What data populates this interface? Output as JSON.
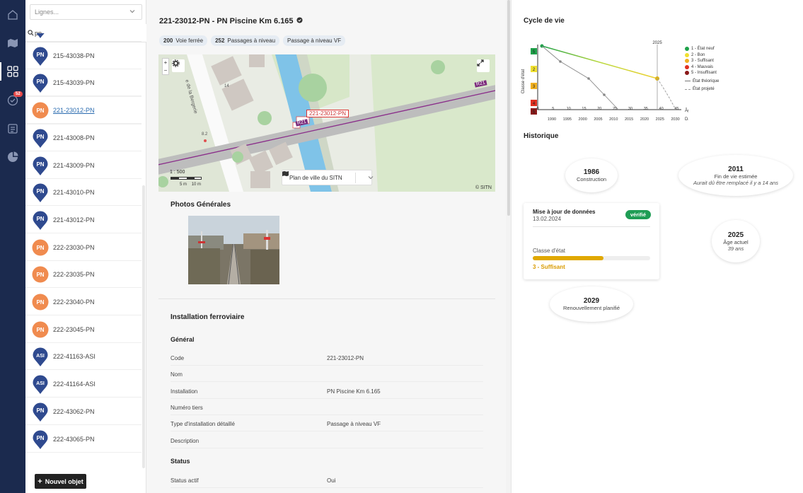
{
  "sidebar_list": {
    "lines_placeholder": "Lignes...",
    "search_value": "pn",
    "items": [
      {
        "label": "215-43035-PN",
        "kind": "PN",
        "color": "#2f4a8f",
        "shape": "pin"
      },
      {
        "label": "215-43038-PN",
        "kind": "PN",
        "color": "#2f4a8f",
        "shape": "pin"
      },
      {
        "label": "215-43039-PN",
        "kind": "PN",
        "color": "#2f4a8f",
        "shape": "pin"
      },
      {
        "label": "221-23012-PN",
        "kind": "PN",
        "color": "#f08b4f",
        "shape": "circle"
      },
      {
        "label": "221-43008-PN",
        "kind": "PN",
        "color": "#2f4a8f",
        "shape": "pin"
      },
      {
        "label": "221-43009-PN",
        "kind": "PN",
        "color": "#2f4a8f",
        "shape": "pin"
      },
      {
        "label": "221-43010-PN",
        "kind": "PN",
        "color": "#2f4a8f",
        "shape": "pin"
      },
      {
        "label": "221-43012-PN",
        "kind": "PN",
        "color": "#2f4a8f",
        "shape": "pin"
      },
      {
        "label": "222-23030-PN",
        "kind": "PN",
        "color": "#f08b4f",
        "shape": "circle"
      },
      {
        "label": "222-23035-PN",
        "kind": "PN",
        "color": "#f08b4f",
        "shape": "circle"
      },
      {
        "label": "222-23040-PN",
        "kind": "PN",
        "color": "#f08b4f",
        "shape": "circle"
      },
      {
        "label": "222-23045-PN",
        "kind": "PN",
        "color": "#f08b4f",
        "shape": "circle"
      },
      {
        "label": "222-41163-ASI",
        "kind": "ASI",
        "color": "#2f4a8f",
        "shape": "pin"
      },
      {
        "label": "222-41164-ASI",
        "kind": "ASI",
        "color": "#2f4a8f",
        "shape": "pin"
      },
      {
        "label": "222-43062-PN",
        "kind": "PN",
        "color": "#2f4a8f",
        "shape": "pin"
      },
      {
        "label": "222-43065-PN",
        "kind": "PN",
        "color": "#2f4a8f",
        "shape": "pin"
      }
    ],
    "selected_item": "221-23012-PN",
    "new_button_label": "Nouvel objet"
  },
  "rail": {
    "icons": [
      "home-icon",
      "map-icon",
      "grid-icon",
      "check-circle-icon",
      "document-icon",
      "pie-chart-icon"
    ],
    "badge_count": "52",
    "active_index": 2
  },
  "detail": {
    "title": "221-23012-PN - PN Piscine Km 6.165",
    "chips": [
      {
        "count": "200",
        "label": "Voie ferrée"
      },
      {
        "count": "252",
        "label": "Passages à niveau"
      },
      {
        "count": "",
        "label": "Passage à niveau VF"
      }
    ],
    "map": {
      "pn_label": "221-23012-PN",
      "road_labels": [
        "R21",
        "R21"
      ],
      "street_label": "e de la Bergerie",
      "scale_ratio": "1 : 500",
      "scale_units": [
        "5 m",
        "10 m"
      ],
      "plan_label": "Plan de ville du SITN",
      "attribution": "© SITN",
      "house_numbers": [
        "14",
        "8.2"
      ]
    },
    "photos_title": "Photos Générales",
    "install_title": "Installation ferroviaire",
    "general_title": "Général",
    "fields": [
      {
        "key": "Code",
        "value": "221-23012-PN"
      },
      {
        "key": "Nom",
        "value": ""
      },
      {
        "key": "Installation",
        "value": "PN Piscine Km 6.165"
      },
      {
        "key": "Numéro tiers",
        "value": ""
      },
      {
        "key": "Type d'installation détaillé",
        "value": "Passage à niveau VF"
      },
      {
        "key": "Description",
        "value": ""
      }
    ],
    "status_title": "Status",
    "status_fields": [
      {
        "key": "Status actif",
        "value": "Oui"
      }
    ]
  },
  "lifecycle": {
    "title": "Cycle de vie",
    "ylabel": "Classe d'état",
    "marker_year": "2025",
    "x_age_ticks": [
      "0",
      "5",
      "10",
      "15",
      "20",
      "25",
      "30",
      "35",
      "40",
      "45"
    ],
    "x_date_ticks": [
      "1990",
      "1995",
      "2000",
      "2005",
      "2010",
      "2015",
      "2020",
      "2025",
      "2030"
    ],
    "x_age_label": "Âge",
    "x_date_label": "Date",
    "y_classes": [
      "5",
      "2",
      "3",
      "4",
      "5"
    ],
    "y_class_colors": [
      "#1fa24a",
      "#f0e030",
      "#f0b020",
      "#e03020",
      "#8b1a1a"
    ],
    "legend": [
      {
        "label": "1 - État neuf",
        "color": "#1fa24a"
      },
      {
        "label": "2 - Bon",
        "color": "#f0e030"
      },
      {
        "label": "3 - Suffisant",
        "color": "#f0b020"
      },
      {
        "label": "4 - Mauvais",
        "color": "#e03020"
      },
      {
        "label": "5 - Insuffisant",
        "color": "#8b1a1a"
      },
      {
        "label": "État théorique",
        "color": "#777777"
      },
      {
        "label": "État projeté",
        "color": "#999999"
      }
    ]
  },
  "history": {
    "title": "Historique",
    "construction": {
      "year": "1986",
      "label": "Construction"
    },
    "end_of_life": {
      "year": "2011",
      "label": "Fin de vie estimée",
      "note": "Aurait dû être remplacé il y a 14 ans"
    },
    "update_card": {
      "title": "Mise à jour de données",
      "date": "13.02.2024",
      "badge": "vérifié",
      "class_label": "Classe d'état",
      "class_value": "3 - Suffisant",
      "class_fill": 0.6
    },
    "current_age": {
      "year": "2025",
      "label": "Âge actuel",
      "note": "39 ans"
    },
    "renewal": {
      "year": "2029",
      "label": "Renouvellement planifié"
    }
  }
}
